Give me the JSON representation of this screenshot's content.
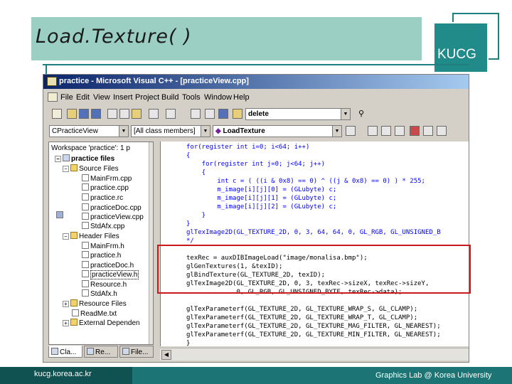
{
  "slide": {
    "title": "Load.Texture( )",
    "logo": "KUCG",
    "footer_url": "kucg.korea.ac.kr",
    "footer_lab": "Graphics Lab @ Korea University",
    "colors": {
      "teal": "#1c7574",
      "teal_dark": "#0f5251",
      "band": "#9ccfc3",
      "highlight_border": "#c9191b"
    }
  },
  "window": {
    "title": "practice - Microsoft Visual C++ - [practiceView.cpp]",
    "menu": [
      "File",
      "Edit",
      "View",
      "Insert",
      "Project",
      "Build",
      "Tools",
      "Window",
      "Help"
    ],
    "find_combo": "delete",
    "class_combo": "CPracticeView",
    "members_combo": "[All class members]",
    "function_combo": "LoadTexture",
    "icons": [
      "new-file-icon",
      "open-icon",
      "save-icon",
      "save-all-icon",
      "cut-icon",
      "copy-icon",
      "paste-icon",
      "undo-icon",
      "redo-icon",
      "workspace-icon",
      "output-icon",
      "window-list-icon",
      "find-in-files-icon",
      "binoculars-icon",
      "class-wizard-icon",
      "compile-icon",
      "build-icon",
      "stop-build-icon",
      "execute-icon",
      "go-icon",
      "breakpoint-icon"
    ]
  },
  "workspace": {
    "items": [
      {
        "label": "Workspace 'practice': 1 p",
        "kind": "workspace",
        "level": 0
      },
      {
        "label": "practice files",
        "kind": "project",
        "level": 1,
        "expander": "-"
      },
      {
        "label": "Source Files",
        "kind": "folder",
        "level": 2,
        "expander": "-"
      },
      {
        "label": "MainFrm.cpp",
        "kind": "file",
        "level": 3
      },
      {
        "label": "practice.cpp",
        "kind": "file",
        "level": 3
      },
      {
        "label": "practice.rc",
        "kind": "file",
        "level": 3
      },
      {
        "label": "practiceDoc.cpp",
        "kind": "file",
        "level": 3
      },
      {
        "label": "practiceView.cpp",
        "kind": "file",
        "level": 3
      },
      {
        "label": "StdAfx.cpp",
        "kind": "file",
        "level": 3
      },
      {
        "label": "Header Files",
        "kind": "folder",
        "level": 2,
        "expander": "-"
      },
      {
        "label": "MainFrm.h",
        "kind": "file",
        "level": 3
      },
      {
        "label": "practice.h",
        "kind": "file",
        "level": 3
      },
      {
        "label": "practiceDoc.h",
        "kind": "file",
        "level": 3
      },
      {
        "label": "practiceView.h",
        "kind": "file",
        "level": 3,
        "selected": true
      },
      {
        "label": "Resource.h",
        "kind": "file",
        "level": 3
      },
      {
        "label": "StdAfx.h",
        "kind": "file",
        "level": 3
      },
      {
        "label": "Resource Files",
        "kind": "folder",
        "level": 2,
        "expander": "+"
      },
      {
        "label": "ReadMe.txt",
        "kind": "file",
        "level": 2
      },
      {
        "label": "External Dependen",
        "kind": "folder",
        "level": 2,
        "expander": "+"
      }
    ],
    "tabs": [
      "Cla...",
      "Re...",
      "File..."
    ]
  },
  "code": {
    "lines": [
      {
        "text": "for(register int i=0; i<64; i++)",
        "color": "#0000ff"
      },
      {
        "text": "{",
        "color": "#0000ff"
      },
      {
        "text": "    for(register int j=0; j<64; j++)",
        "color": "#0000ff"
      },
      {
        "text": "    {",
        "color": "#0000ff"
      },
      {
        "text": "        int c = ( ((i & 0x8) == 0) ^ ((j & 0x8) == 0) ) * 255;",
        "color": "#0000ff"
      },
      {
        "text": "        m_image[i][j][0] = (GLubyte) c;",
        "color": "#0000ff"
      },
      {
        "text": "        m_image[i][j][1] = (GLubyte) c;",
        "color": "#0000ff"
      },
      {
        "text": "        m_image[i][j][2] = (GLubyte) c;",
        "color": "#0000ff"
      },
      {
        "text": "    }",
        "color": "#0000ff"
      },
      {
        "text": "}",
        "color": "#0000ff"
      },
      {
        "text": "glTexImage2D(GL_TEXTURE_2D, 0, 3, 64, 64, 0, GL_RGB, GL_UNSIGNED_B",
        "color": "#0000ff"
      },
      {
        "text": "*/",
        "color": "#0000ff"
      },
      {
        "text": "",
        "color": "#000000"
      },
      {
        "text": "texRec = auxDIBImageLoad(\"image/monalisa.bmp\");",
        "color": "#000000"
      },
      {
        "text": "glGenTextures(1, &texID);",
        "color": "#000000"
      },
      {
        "text": "glBindTexture(GL_TEXTURE_2D, texID);",
        "color": "#000000"
      },
      {
        "text": "glTexImage2D(GL_TEXTURE_2D, 0, 3, texRec->sizeX, texRec->sizeY,",
        "color": "#000000"
      },
      {
        "text": "             0, GL_RGB, GL_UNSIGNED_BYTE, texRec->data);",
        "color": "#000000"
      },
      {
        "text": "",
        "color": "#000000"
      },
      {
        "text": "glTexParameterf(GL_TEXTURE_2D, GL_TEXTURE_WRAP_S, GL_CLAMP);",
        "color": "#000000"
      },
      {
        "text": "glTexParameterf(GL_TEXTURE_2D, GL_TEXTURE_WRAP_T, GL_CLAMP);",
        "color": "#000000"
      },
      {
        "text": "glTexParameterf(GL_TEXTURE_2D, GL_TEXTURE_MAG_FILTER, GL_NEAREST);",
        "color": "#000000"
      },
      {
        "text": "glTexParameterf(GL_TEXTURE_2D, GL_TEXTURE_MIN_FILTER, GL_NEAREST);",
        "color": "#000000"
      },
      {
        "text": "}",
        "color": "#000000"
      }
    ]
  }
}
